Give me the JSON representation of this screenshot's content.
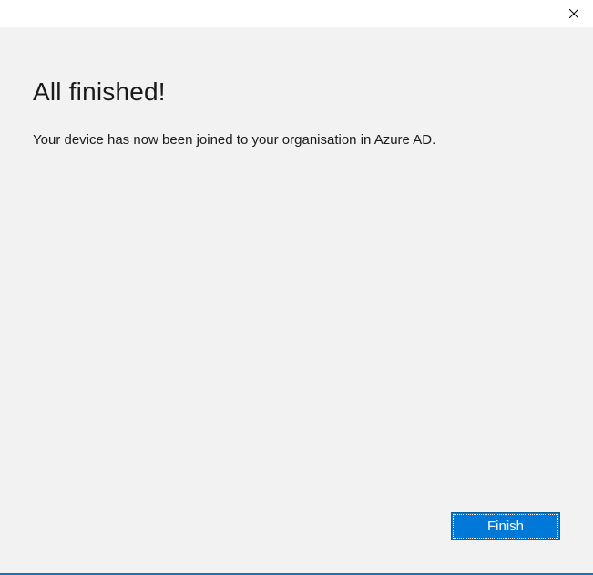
{
  "heading": "All finished!",
  "subtext": "Your device has now been joined to your organisation in Azure AD.",
  "buttons": {
    "finish": "Finish"
  }
}
